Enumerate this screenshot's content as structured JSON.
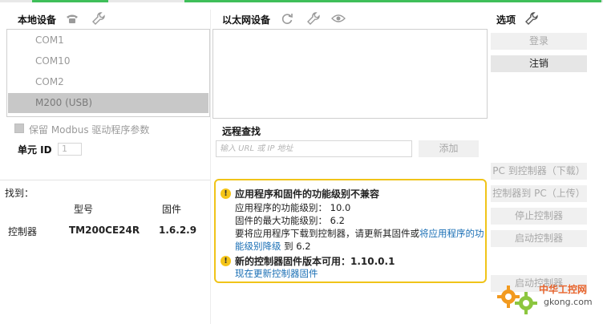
{
  "local_devices": {
    "title": "本地设备",
    "icons": [
      "phone-icon",
      "wrench-icon"
    ],
    "items": [
      {
        "label": "COM1",
        "selected": false
      },
      {
        "label": "COM10",
        "selected": false
      },
      {
        "label": "COM2",
        "selected": false
      },
      {
        "label": "M200 (USB)",
        "selected": true
      }
    ],
    "keep_params_label": "保留 Modbus 驱动程序参数",
    "unit_id_label": "单元 ID",
    "unit_id_value": "1"
  },
  "ethernet_devices": {
    "title": "以太网设备",
    "icons": [
      "refresh-icon",
      "wrench-icon",
      "eye-icon"
    ]
  },
  "remote_search": {
    "title": "远程查找",
    "placeholder": "输入 URL 或 IP 地址",
    "add_label": "添加"
  },
  "options": {
    "title": "选项",
    "login_label": "登录",
    "logout_label": "注销",
    "pc_to_controller_label": "PC 到控制器（下载）",
    "controller_to_pc_label": "控制器到 PC（上传）",
    "stop_controller_label": "停止控制器",
    "start_controller_label": "启动控制器",
    "hidden_button_label": "启动控制器"
  },
  "found": {
    "label": "找到：",
    "col_model": "型号",
    "col_firmware": "固件",
    "row_label": "控制器",
    "row_model": "TM200CE24R",
    "row_firmware": "1.6.2.9"
  },
  "warning": {
    "title1": "应用程序和固件的功能级别不兼容",
    "line_app_level": "应用程序的功能级别： 10.0",
    "line_fw_max": "固件的最大功能级别： 6.2",
    "line_download_prefix": "要将应用程序下载到控制器，请更新其固件或",
    "link_downgrade": "将应用程序的功能级别降级",
    "line_download_suffix": " 到 6.2",
    "title2": "新的控制器固件版本可用：1.10.0.1",
    "link_update": "现在更新控制器固件"
  },
  "watermark": {
    "site_cn": "中华工控网",
    "site_en": "gkong.com"
  },
  "colors": {
    "accent_green": "#3fbf5a",
    "warning_border": "#f0c419",
    "link": "#1a6fb5",
    "selected_bg": "#c8c8c8"
  }
}
